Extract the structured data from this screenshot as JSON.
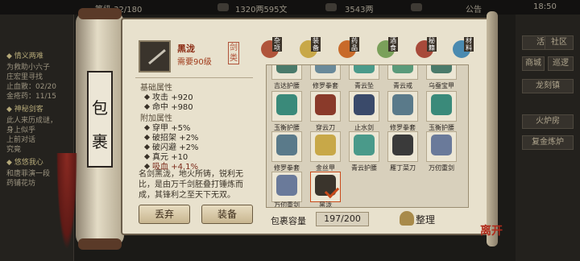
{
  "status_bar": {
    "left_text": "等级 32/180",
    "coins": "1320两595文",
    "ingots": "3543两",
    "notice": "公告",
    "time": "18:50"
  },
  "quests": [
    {
      "text": "◆ 情义两难",
      "head": true
    },
    {
      "text": "为救助小六子",
      "head": false
    },
    {
      "text": "庄宏里寻找",
      "head": false
    },
    {
      "text": "止血散：02/20",
      "head": false
    },
    {
      "text": "金疮药：11/15",
      "head": false
    },
    {
      "text": "◆ 神秘剑客",
      "head": true
    },
    {
      "text": "此人来历成谜，",
      "head": false
    },
    {
      "text": "身上似乎",
      "head": false
    },
    {
      "text": "上前对话",
      "head": false
    },
    {
      "text": "究竟",
      "head": false
    },
    {
      "text": "◆ 悠悠我心",
      "head": true
    },
    {
      "text": "和唐菲演一段",
      "head": false
    },
    {
      "text": "药铺花坊",
      "head": false
    }
  ],
  "side_menu": [
    "活动",
    "社区",
    "商城",
    "巡逻",
    "龙刻镇",
    "火炉房",
    "复金炼炉"
  ],
  "scroll_title": [
    "包",
    "裹"
  ],
  "item": {
    "name": "黑泷",
    "level_req": "需要90级",
    "type_badge": "剑类",
    "base_title": "基础属性",
    "base_stats": [
      {
        "name": "攻击",
        "value": "+920"
      },
      {
        "name": "命中",
        "value": "+980"
      }
    ],
    "extra_title": "附加属性",
    "extra_stats": [
      {
        "name": "穿甲",
        "value": "+5%"
      },
      {
        "name": "破招架",
        "value": "+2%"
      },
      {
        "name": "破闪避",
        "value": "+2%"
      },
      {
        "name": "真元",
        "value": "+10"
      },
      {
        "name": "吸血",
        "value": "+4.1%"
      }
    ],
    "description": "名剑黑泷，地火所铸，锐利无比，是由万千剑胚叠打锤炼而成，其锋利之至天下无双。"
  },
  "buttons": {
    "discard": "丢弃",
    "equip": "装备",
    "sort": "整理"
  },
  "tabs": [
    {
      "label": "杂项",
      "color": "#b0543a"
    },
    {
      "label": "装备",
      "color": "#c8a848"
    },
    {
      "label": "药品",
      "color": "#c86a2a"
    },
    {
      "label": "酒食",
      "color": "#7aa05a"
    },
    {
      "label": "秘籍",
      "color": "#a84a3a"
    },
    {
      "label": "材料",
      "color": "#4a8ab0"
    }
  ],
  "inventory": [
    {
      "label": "吉达护腰",
      "color": "#4a7a6a"
    },
    {
      "label": "修罗拳套",
      "color": "#6a8a9a"
    },
    {
      "label": "青云坠",
      "color": "#4a9a8a"
    },
    {
      "label": "青云戒",
      "color": "#5a9a7a"
    },
    {
      "label": "乌蚕宝甲",
      "color": "#4a7a6a"
    },
    {
      "label": "玉衡护腰",
      "color": "#3a8a7a"
    },
    {
      "label": "穿云刀",
      "color": "#8a3a2a"
    },
    {
      "label": "止水剑",
      "color": "#3a4a6a"
    },
    {
      "label": "修罗拳套",
      "color": "#5a7a8a"
    },
    {
      "label": "玉衡护腰",
      "color": "#3a8a7a"
    },
    {
      "label": "修罗拳套",
      "color": "#5a7a8a"
    },
    {
      "label": "金丝甲",
      "color": "#c8a848"
    },
    {
      "label": "青云护腰",
      "color": "#4a9a8a"
    },
    {
      "label": "雁丁菜刀",
      "color": "#3a3a3a"
    },
    {
      "label": "万仞重剑",
      "color": "#6a7a9a"
    },
    {
      "label": "万仞重剑",
      "color": "#6a7a9a"
    },
    {
      "label": "黑泷",
      "color": "#3a342c"
    }
  ],
  "capacity": {
    "label": "包裹容量",
    "value": "197/200"
  },
  "seal": "离开"
}
